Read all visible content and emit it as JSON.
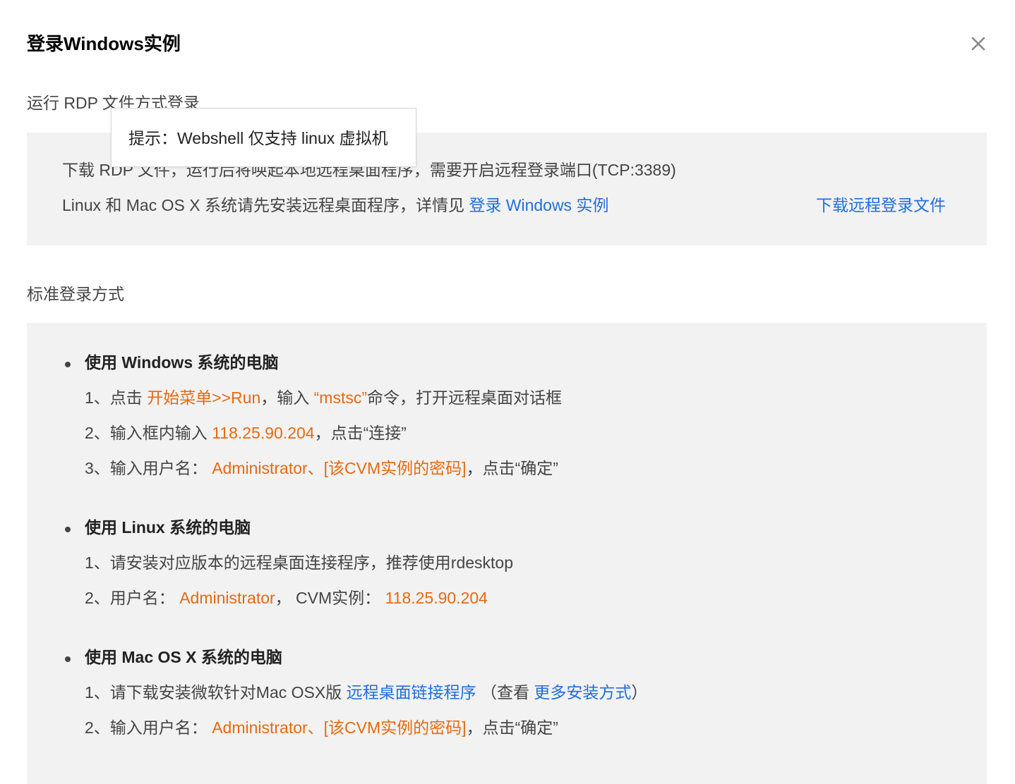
{
  "dialog": {
    "title": "登录Windows实例",
    "close_icon": "close-icon"
  },
  "rdp": {
    "section_title": "运行 RDP 文件方式登录",
    "line1": "下载 RDP 文件，运行后将唤起本地远程桌面程序，需要开启远程登录端口(TCP:3389)",
    "line2_prefix": "Linux 和 Mac OS X 系统请先安装远程桌面程序，详情见 ",
    "line2_link": "登录 Windows 实例",
    "download_link": "下载远程登录文件"
  },
  "tooltip": {
    "text": "提示：Webshell 仅支持 linux 虚拟机"
  },
  "standard": {
    "section_title": "标准登录方式",
    "windows": {
      "heading": "使用 Windows 系统的电脑",
      "step1": {
        "prefix": "1、点击 ",
        "hl1": "开始菜单>>Run",
        "mid": "，输入 ",
        "hl2": "“mstsc”",
        "suffix": "命令，打开远程桌面对话框"
      },
      "step2": {
        "prefix": "2、输入框内输入 ",
        "hl": "118.25.90.204",
        "suffix": "，点击“连接”"
      },
      "step3": {
        "prefix": "3、输入用户名： ",
        "hl": "Administrator、[该CVM实例的密码]",
        "suffix": "，点击“确定”"
      }
    },
    "linux": {
      "heading": "使用 Linux 系统的电脑",
      "step1": "1、请安装对应版本的远程桌面连接程序，推荐使用rdesktop",
      "step2": {
        "prefix": "2、用户名： ",
        "hl1": "Administrator",
        "mid": "， CVM实例： ",
        "hl2": "118.25.90.204"
      }
    },
    "mac": {
      "heading": "使用 Mac OS X 系统的电脑",
      "step1": {
        "prefix": "1、请下载安装微软针对Mac OSX版 ",
        "link1": "远程桌面链接程序",
        "mid": " （查看 ",
        "link2": "更多安装方式",
        "suffix": "）"
      },
      "step2": {
        "prefix": "2、输入用户名： ",
        "hl": "Administrator、[该CVM实例的密码]",
        "suffix": "，点击“确定”"
      }
    }
  },
  "colors": {
    "link": "#1f6fe0",
    "highlight": "#e8690f",
    "panel_bg": "#f2f2f2"
  }
}
